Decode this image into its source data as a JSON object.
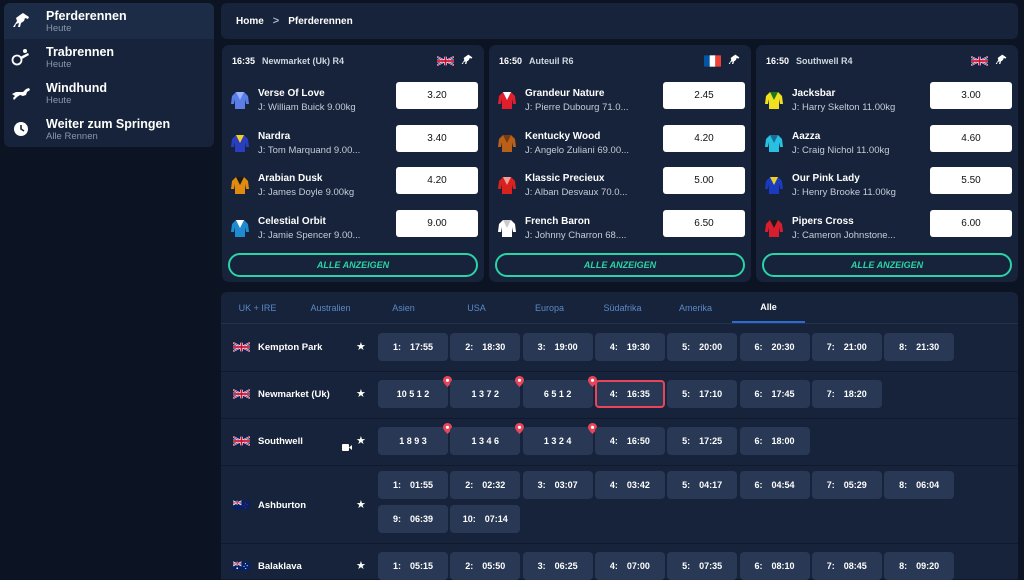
{
  "sidebar": {
    "items": [
      {
        "label": "Pferderennen",
        "sub": "Heute",
        "icon": "horse-icon"
      },
      {
        "label": "Trabrennen",
        "sub": "Heute",
        "icon": "harness-icon"
      },
      {
        "label": "Windhund",
        "sub": "Heute",
        "icon": "greyhound-icon"
      },
      {
        "label": "Weiter zum Springen",
        "sub": "Alle Rennen",
        "icon": "clock-icon"
      }
    ]
  },
  "breadcrumb": {
    "home": "Home",
    "sep": ">",
    "current": "Pferderennen"
  },
  "cards": [
    {
      "time": "16:35",
      "venue": "Newmarket (Uk) R4",
      "flag": "uk",
      "runners": [
        {
          "name": "Verse Of Love",
          "jockey": "J: William Buick 9.00kg",
          "odds": "3.20"
        },
        {
          "name": "Nardra",
          "jockey": "J: Tom Marquand 9.00...",
          "odds": "3.40"
        },
        {
          "name": "Arabian Dusk",
          "jockey": "J: James Doyle 9.00kg",
          "odds": "4.20"
        },
        {
          "name": "Celestial Orbit",
          "jockey": "J: Jamie Spencer 9.00...",
          "odds": "9.00"
        }
      ],
      "button": "ALLE ANZEIGEN"
    },
    {
      "time": "16:50",
      "venue": "Auteuil R6",
      "flag": "fr",
      "runners": [
        {
          "name": "Grandeur Nature",
          "jockey": "J: Pierre Dubourg 71.0...",
          "odds": "2.45"
        },
        {
          "name": "Kentucky Wood",
          "jockey": "J: Angelo Zuliani 69.00...",
          "odds": "4.20"
        },
        {
          "name": "Klassic Precieux",
          "jockey": "J: Alban Desvaux 70.0...",
          "odds": "5.00"
        },
        {
          "name": "French Baron",
          "jockey": "J: Johnny Charron 68....",
          "odds": "6.50"
        }
      ],
      "button": "ALLE ANZEIGEN"
    },
    {
      "time": "16:50",
      "venue": "Southwell R4",
      "flag": "uk",
      "runners": [
        {
          "name": "Jacksbar",
          "jockey": "J: Harry Skelton 11.00kg",
          "odds": "3.00"
        },
        {
          "name": "Aazza",
          "jockey": "J: Craig Nichol 11.00kg",
          "odds": "4.60"
        },
        {
          "name": "Our Pink Lady",
          "jockey": "J: Henry Brooke 11.00kg",
          "odds": "5.50"
        },
        {
          "name": "Pipers Cross",
          "jockey": "J: Cameron Johnstone...",
          "odds": "6.00"
        }
      ],
      "button": "ALLE ANZEIGEN"
    }
  ],
  "tabs": [
    {
      "label": "UK + IRE",
      "active": false
    },
    {
      "label": "Australien",
      "active": false
    },
    {
      "label": "Asien",
      "active": false
    },
    {
      "label": "USA",
      "active": false
    },
    {
      "label": "Europa",
      "active": false
    },
    {
      "label": "Südafrika",
      "active": false
    },
    {
      "label": "Amerika",
      "active": false
    },
    {
      "label": "Alle",
      "active": true
    }
  ],
  "tracks": [
    {
      "name": "Kempton Park",
      "flag": "uk",
      "camera": false,
      "races": [
        {
          "n": "1:",
          "t": "17:55"
        },
        {
          "n": "2:",
          "t": "18:30"
        },
        {
          "n": "3:",
          "t": "19:00"
        },
        {
          "n": "4:",
          "t": "19:30"
        },
        {
          "n": "5:",
          "t": "20:00"
        },
        {
          "n": "6:",
          "t": "20:30"
        },
        {
          "n": "7:",
          "t": "21:00"
        },
        {
          "n": "8:",
          "t": "21:30"
        }
      ]
    },
    {
      "name": "Newmarket (Uk)",
      "flag": "uk",
      "camera": false,
      "races": [
        {
          "n": "",
          "t": "10 5 1 2",
          "pin": true
        },
        {
          "n": "",
          "t": "1 3 7 2",
          "pin": true
        },
        {
          "n": "",
          "t": "6 5 1 2",
          "pin": true
        },
        {
          "n": "4:",
          "t": "16:35",
          "selected": true
        },
        {
          "n": "5:",
          "t": "17:10"
        },
        {
          "n": "6:",
          "t": "17:45"
        },
        {
          "n": "7:",
          "t": "18:20"
        }
      ]
    },
    {
      "name": "Southwell",
      "flag": "uk",
      "camera": true,
      "races": [
        {
          "n": "",
          "t": "1 8 9 3",
          "pin": true
        },
        {
          "n": "",
          "t": "1 3 4 6",
          "pin": true
        },
        {
          "n": "",
          "t": "1 3 2 4",
          "pin": true
        },
        {
          "n": "4:",
          "t": "16:50"
        },
        {
          "n": "5:",
          "t": "17:25"
        },
        {
          "n": "6:",
          "t": "18:00"
        }
      ]
    },
    {
      "name": "Ashburton",
      "flag": "nz",
      "camera": false,
      "races": [
        {
          "n": "1:",
          "t": "01:55"
        },
        {
          "n": "2:",
          "t": "02:32"
        },
        {
          "n": "3:",
          "t": "03:07"
        },
        {
          "n": "4:",
          "t": "03:42"
        },
        {
          "n": "5:",
          "t": "04:17"
        },
        {
          "n": "6:",
          "t": "04:54"
        },
        {
          "n": "7:",
          "t": "05:29"
        },
        {
          "n": "8:",
          "t": "06:04"
        },
        {
          "n": "9:",
          "t": "06:39"
        },
        {
          "n": "10:",
          "t": "07:14"
        }
      ]
    },
    {
      "name": "Balaklava",
      "flag": "au",
      "camera": false,
      "races": [
        {
          "n": "1:",
          "t": "05:15"
        },
        {
          "n": "2:",
          "t": "05:50"
        },
        {
          "n": "3:",
          "t": "06:25"
        },
        {
          "n": "4:",
          "t": "07:00"
        },
        {
          "n": "5:",
          "t": "07:35"
        },
        {
          "n": "6:",
          "t": "08:10"
        },
        {
          "n": "7:",
          "t": "08:45"
        },
        {
          "n": "8:",
          "t": "09:20"
        }
      ]
    }
  ],
  "colors": {
    "accent": "#2bd4a6",
    "selected": "#e8455a",
    "tab_active": "#2c6bd1"
  }
}
